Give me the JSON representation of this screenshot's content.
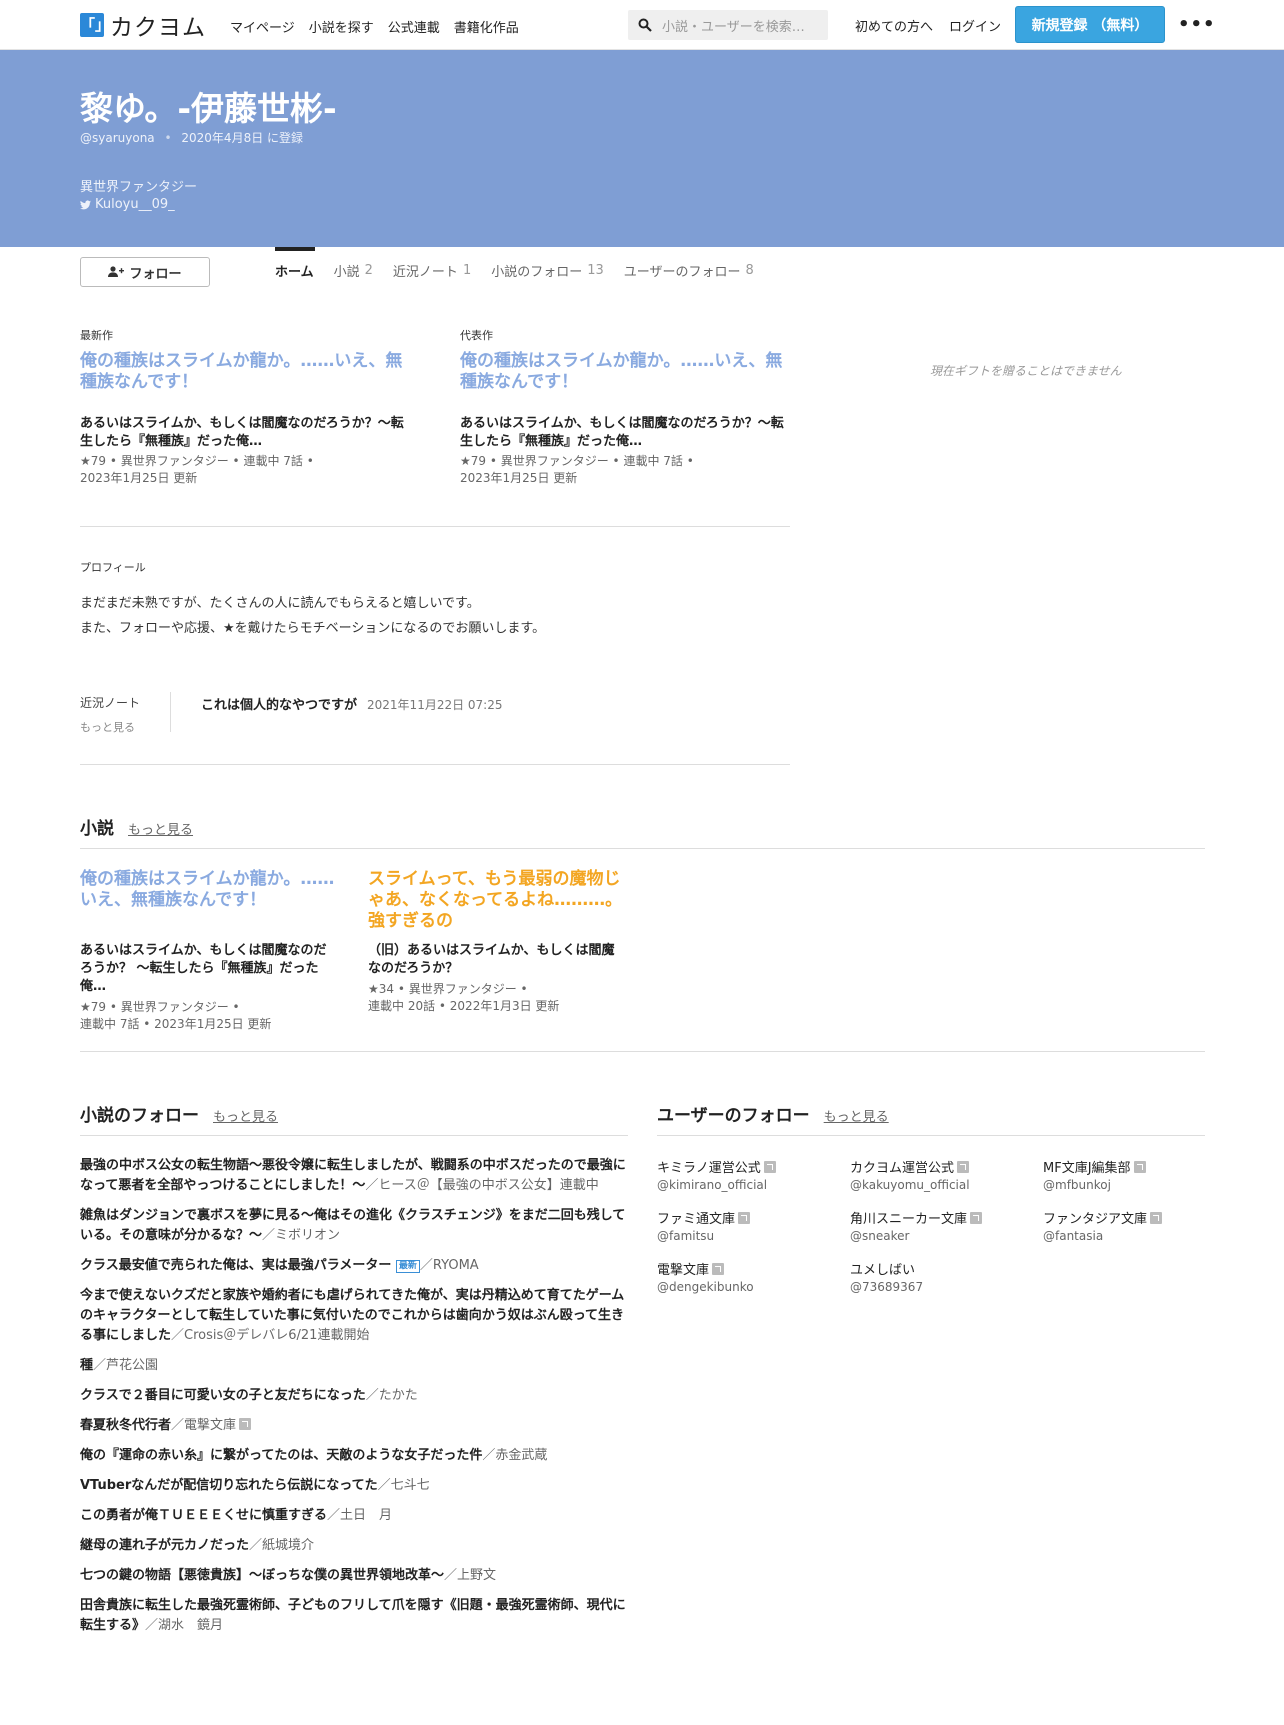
{
  "header": {
    "logo_mark": "「」",
    "logo_text": "カクヨム",
    "nav": [
      "マイページ",
      "小説を探す",
      "公式連載",
      "書籍化作品"
    ],
    "search_placeholder": "小説・ユーザーを検索…",
    "first_time": "初めての方へ",
    "login": "ログイン",
    "signup": "新規登録 （無料）",
    "more": "•••"
  },
  "profile": {
    "name": "黎ゆ。-伊藤世彬-",
    "handle": "@syaruyona",
    "registered": "2020年4月8日 に登録",
    "genre": "異世界ファンタジー",
    "twitter": "Kuloyu__09_",
    "follow_button": "フォロー"
  },
  "tabs": [
    {
      "label": "ホーム",
      "count": ""
    },
    {
      "label": "小説",
      "count": "2"
    },
    {
      "label": "近況ノート",
      "count": "1"
    },
    {
      "label": "小説のフォロー",
      "count": "13"
    },
    {
      "label": "ユーザーのフォロー",
      "count": "8"
    }
  ],
  "latest": {
    "label": "最新作",
    "title": "俺の種族はスライムか龍か。……いえ、無種族なんです！",
    "subtitle": "あるいはスライムか、もしくは閻魔なのだろうか？〜転生したら『無種族』だった俺…",
    "meta1": "★79 • 異世界ファンタジー • 連載中 7話 •",
    "meta2": "2023年1月25日 更新"
  },
  "featured": {
    "label": "代表作",
    "title": "俺の種族はスライムか龍か。……いえ、無種族なんです！",
    "subtitle": "あるいはスライムか、もしくは閻魔なのだろうか？〜転生したら『無種族』だった俺…",
    "meta1": "★79 • 異世界ファンタジー • 連載中 7話 •",
    "meta2": "2023年1月25日 更新"
  },
  "gift_note": "現在ギフトを贈ることはできません",
  "profile_section": {
    "label": "プロフィール",
    "line1": "まだまだ未熟ですが、たくさんの人に読んでもらえると嬉しいです。",
    "line2": "また、フォローや応援、★を戴けたらモチベーションになるのでお願いします。"
  },
  "notes": {
    "label": "近況ノート",
    "more": "もっと見る",
    "title": "これは個人的なやつですが",
    "date": "2021年11月22日 07:25"
  },
  "novels": {
    "heading": "小説",
    "more": "もっと見る",
    "items": [
      {
        "title": "俺の種族はスライムか龍か。……いえ、無種族なんです！",
        "subtitle": "あるいはスライムか、もしくは閻魔なのだろうか？ 〜転生したら『無種族』だった俺…",
        "meta1": "★79 • 異世界ファンタジー •",
        "meta2": "連載中 7話 • 2023年1月25日 更新"
      },
      {
        "title": "スライムって、もう最弱の魔物じゃあ、なくなってるよね………。強すぎるの",
        "subtitle": "（旧）あるいはスライムか、もしくは閻魔なのだろうか？",
        "meta1": "★34 • 異世界ファンタジー •",
        "meta2": "連載中 20話 • 2022年1月3日 更新"
      }
    ]
  },
  "novel_follows": {
    "heading": "小説のフォロー",
    "more": "もっと見る",
    "new_badge": "最新",
    "items": [
      {
        "title": "最強の中ボス公女の転生物語～悪役令嬢に転生しましたが、戦闘系の中ボスだったので最強になって悪者を全部やっつけることにしました！～",
        "author": "／ヒース＠【最強の中ボス公女】連載中"
      },
      {
        "title": "雑魚はダンジョンで裏ボスを夢に見る～俺はその進化《クラスチェンジ》をまだ二回も残している。その意味が分かるな？～",
        "author": "／ミボリオン"
      },
      {
        "title": "クラス最安値で売られた俺は、実は最強パラメーター",
        "author": "／RYOMA"
      },
      {
        "title": "今まで使えないクズだと家族や婚約者にも虐げられてきた俺が、実は丹精込めて育てたゲームのキャラクターとして転生していた事に気付いたのでこれからは歯向かう奴はぶん殴って生きる事にしました",
        "author": "／Crosis＠デレバレ6/21連載開始"
      },
      {
        "title": "種",
        "author": "／芦花公園"
      },
      {
        "title": "クラスで２番目に可愛い女の子と友だちになった",
        "author": "／たかた"
      },
      {
        "title": "春夏秋冬代行者",
        "author": "／電撃文庫"
      },
      {
        "title": "俺の『運命の赤い糸』に繋がってたのは、天敵のような女子だった件",
        "author": "／赤金武蔵"
      },
      {
        "title": "VTuberなんだが配信切り忘れたら伝説になってた",
        "author": "／七斗七"
      },
      {
        "title": "この勇者が俺ＴＵＥＥＥくせに慎重すぎる",
        "author": "／土日　月"
      },
      {
        "title": "継母の連れ子が元カノだった",
        "author": "／紙城境介"
      },
      {
        "title": "七つの鍵の物語【悪徳貴族】～ぼっちな僕の異世界領地改革～",
        "author": "／上野文"
      },
      {
        "title": "田舎貴族に転生した最強死霊術師、子どものフリして爪を隠す《旧題・最強死霊術師、現代に転生する》",
        "author": "／湖水　鏡月"
      }
    ]
  },
  "user_follows": {
    "heading": "ユーザーのフォロー",
    "more": "もっと見る",
    "items": [
      {
        "name": "キミラノ運営公式",
        "id": "@kimirano_official"
      },
      {
        "name": "カクヨム運営公式",
        "id": "@kakuyomu_official"
      },
      {
        "name": "MF文庫J編集部",
        "id": "@mfbunkoj"
      },
      {
        "name": "ファミ通文庫",
        "id": "@famitsu"
      },
      {
        "name": "角川スニーカー文庫",
        "id": "@sneaker"
      },
      {
        "name": "ファンタジア文庫",
        "id": "@fantasia"
      },
      {
        "name": "電撃文庫",
        "id": "@dengekibunko"
      },
      {
        "name": "ユメしばい",
        "id": "@73689367"
      }
    ]
  }
}
